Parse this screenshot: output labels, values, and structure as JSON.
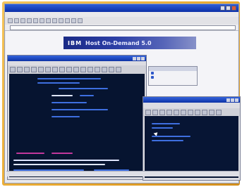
{
  "browser": {
    "title": "",
    "menu": [
      "",
      "",
      "",
      "",
      "",
      ""
    ],
    "address_label": "",
    "address_value": "",
    "toolbar_button_count": 12
  },
  "banner": {
    "logo": "IBM",
    "text": "Host On-Demand 5.0"
  },
  "window_a": {
    "title": "",
    "menu": [
      "",
      "",
      "",
      "",
      "",
      "",
      ""
    ]
  },
  "popup": {
    "items": [
      "",
      ""
    ]
  },
  "window_b": {
    "title": ""
  },
  "colors": {
    "titlebar": "#0b2fa8",
    "terminal_bg": "#061430",
    "terminal_text_blue": "#3e6fe0",
    "terminal_text_magenta": "#c2389c",
    "terminal_text_white": "#dfe6ff"
  }
}
